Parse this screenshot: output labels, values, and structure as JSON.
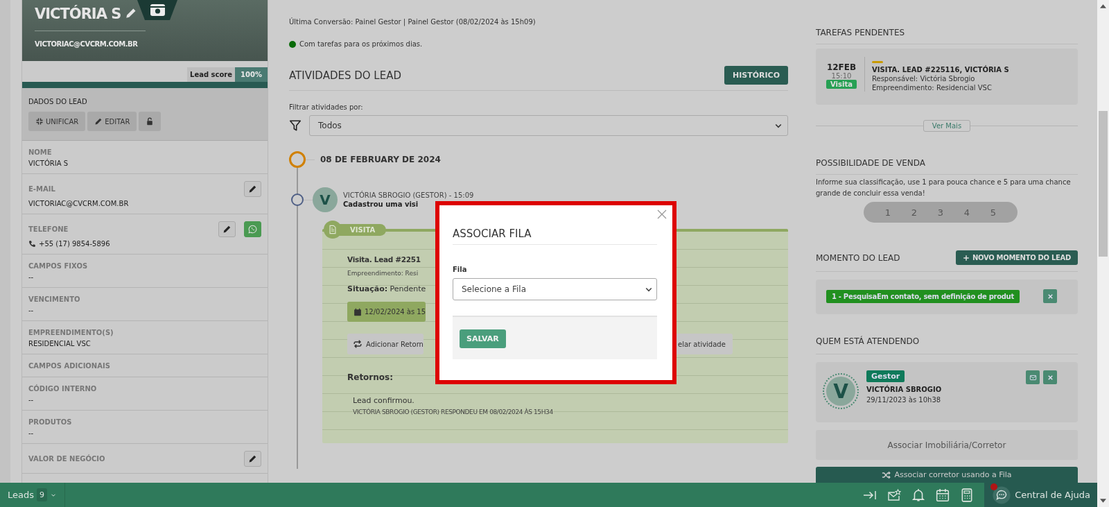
{
  "lead_header": {
    "name": "VICTÓRIA S",
    "email": "VICTORIAC@CVCRM.COM.BR"
  },
  "lead_score": {
    "label": "Lead score",
    "value": "100%"
  },
  "lead_data": {
    "title": "DADOS DO LEAD",
    "buttons": [
      {
        "kind": "unify",
        "label": "UNIFICAR"
      },
      {
        "kind": "edit",
        "label": "EDITAR"
      },
      {
        "kind": "lock"
      }
    ]
  },
  "fields": [
    {
      "kind": "text",
      "label": "NOME",
      "value": "VICTÓRIA S"
    },
    {
      "kind": "text",
      "label": "E-MAIL",
      "value": "VICTORIAC@CVCRM.COM.BR",
      "actions": [
        {
          "kind": "edit"
        }
      ]
    },
    {
      "kind": "phone",
      "label": "TELEFONE",
      "value": "+55 (17) 9854-5896",
      "actions": [
        {
          "kind": "edit"
        },
        {
          "kind": "whatsapp"
        }
      ]
    },
    {
      "kind": "text",
      "label": "CAMPOS FIXOS",
      "value": "--"
    },
    {
      "kind": "text",
      "label": "VENCIMENTO",
      "value": "--"
    },
    {
      "kind": "text",
      "label": "EMPREENDIMENTO(S)",
      "value": "RESIDENCIAL VSC"
    },
    {
      "kind": "text",
      "label": "CAMPOS ADICIONAIS"
    },
    {
      "kind": "text",
      "label": "CÓDIGO INTERNO",
      "value": "--"
    },
    {
      "kind": "text",
      "label": "PRODUTOS",
      "value": "--"
    },
    {
      "kind": "text",
      "label": "VALOR DE NEGÓCIO",
      "actions": [
        {
          "kind": "edit"
        }
      ]
    }
  ],
  "last_conversion": "Última Conversão: Painel Gestor | Painel Gestor (08/02/2024 às 15h09)",
  "task_status": "Com tarefas para os próximos dias.",
  "activities": {
    "title": "ATIVIDADES DO LEAD",
    "history_button": "HISTÓRICO",
    "filter_label": "Filtrar atividades por:",
    "filter_value": "Todos"
  },
  "timeline": {
    "date": "08 DE FEBRUARY DE 2024",
    "entries": [
      {
        "avatar": "V",
        "author": "VICTÓRIA SBROGIO (GESTOR) - 15:09",
        "action": "Cadastrou uma visi",
        "tag": "VISITA",
        "title": "Visita. Lead #2251",
        "detail": "Empreendimento: Resi",
        "status_label": "Situação:",
        "status": "Pendente",
        "date": "12/02/2024 às 15",
        "buttons": [
          {
            "kind": "repeat",
            "label": "Adicionar Retorn"
          },
          {
            "kind": "plain",
            "label": "elar atividade"
          }
        ],
        "replies_title": "Retornos:",
        "replies": [
          {
            "text": "Lead confirmou.",
            "meta": "VICTÓRIA SBROGIO (GESTOR) RESPONDEU EM 08/02/2024 ÀS 15H34"
          }
        ]
      }
    ]
  },
  "tasks": {
    "title": "TAREFAS PENDENTES",
    "items": [
      {
        "day": "12FEB",
        "time": "15:10",
        "type": "Visita",
        "color": "#c89a00",
        "title": "VISITA. LEAD #225116, VICTÓRIA S",
        "lines": [
          "Responsável: Victória Sbrogio",
          "Empreendimento: Residencial VSC"
        ]
      }
    ],
    "more": "Ver Mais"
  },
  "sale_chance": {
    "title": "POSSIBILIDADE DE VENDA",
    "description": "Informe sua classificação, use 1 para pouca chance e 5 para uma chance grande de concluir essa venda!",
    "options": [
      {
        "label": "1",
        "selected": false
      },
      {
        "label": "2",
        "selected": false
      },
      {
        "label": "3",
        "selected": false
      },
      {
        "label": "4",
        "selected": false
      },
      {
        "label": "5",
        "selected": false
      }
    ]
  },
  "lead_moment": {
    "title": "MOMENTO DO LEAD",
    "button": "NOVO MOMENTO DO LEAD",
    "tag": "1 - PesquisaEm contato, sem definição de produt"
  },
  "attendants": {
    "title": "QUEM ESTÁ ATENDENDO",
    "items": [
      {
        "avatar": "V",
        "role": "Gestor",
        "name": "VICTÓRIA SBROGIO",
        "date": "29/11/2023 às 10h38"
      }
    ]
  },
  "associate_button": "Associar Imobiliária/Corretor",
  "queue_button": "Associar corretor usando a Fila",
  "bottom_bar": {
    "leads_label": "Leads",
    "leads_count": "9",
    "help": "Central de Ajuda",
    "notification": true
  },
  "modal": {
    "title": "ASSOCIAR FILA",
    "field_label": "Fila",
    "placeholder": "Selecione a Fila",
    "save": "SALVAR"
  }
}
